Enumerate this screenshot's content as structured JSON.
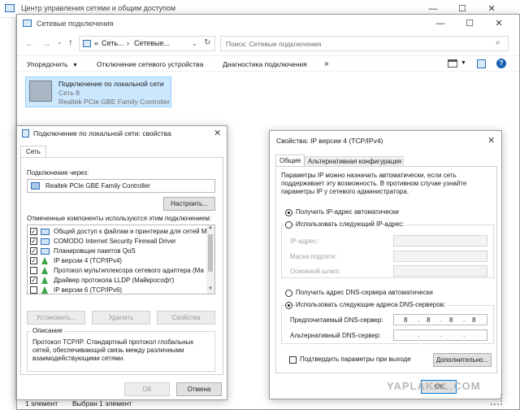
{
  "bg_window": {
    "title": "Центр управления сетями и общим доступом"
  },
  "explorer": {
    "title": "Сетевые подключения",
    "breadcrumb_prefix": "«",
    "breadcrumb_1": "Сеть...",
    "breadcrumb_sep": "›",
    "breadcrumb_2": "Сетевые...",
    "search_placeholder": "Поиск: Сетевые подключения",
    "toolbar": {
      "organize": "Упорядочить",
      "disable": "Отключение сетевого устройства",
      "diagnose": "Диагностика подключения",
      "rename_overflow": "»"
    },
    "connection": {
      "name": "Подключение по локальной сети",
      "network": "Сеть  8",
      "adapter": "Realtek PCIe GBE Family Controller"
    },
    "status": {
      "count": "1 элемент",
      "selected": "Выбран 1 элемент"
    }
  },
  "props": {
    "title": "Подключение по локальной сети: свойства",
    "tab": "Сеть",
    "connect_via_label": "Подключение через:",
    "adapter": "Realtek PCIe GBE Family Controller",
    "configure": "Настроить...",
    "components_label": "Отмеченные компоненты используются этим подключением:",
    "components": [
      {
        "checked": true,
        "label": "Общий доступ к файлам и принтерам для сетей Mi"
      },
      {
        "checked": true,
        "label": "COMODO Internet Security Firewall Driver"
      },
      {
        "checked": true,
        "label": "Планировщик пакетов QoS"
      },
      {
        "checked": true,
        "label": "IP версии 4 (TCP/IPv4)"
      },
      {
        "checked": false,
        "label": "Протокол мультиплексора сетевого адаптера (Ма"
      },
      {
        "checked": true,
        "label": "Драйвер протокола LLDP (Майкрософт)"
      },
      {
        "checked": false,
        "label": "IP версии 6 (TCP/IPv6)"
      }
    ],
    "install": "Установить...",
    "remove": "Удалить",
    "properties": "Свойства",
    "description_title": "Описание",
    "description": "Протокол TCP/IP. Стандартный протокол глобальных сетей, обеспечивающий связь между различными взаимодействующими сетями.",
    "ok": "ОК",
    "cancel": "Отмена"
  },
  "ipv4": {
    "title": "Свойства: IP версии 4 (TCP/IPv4)",
    "tab_general": "Общие",
    "tab_alt": "Альтернативная конфигурация",
    "intro": "Параметры IP можно назначать автоматически, если сеть поддерживает эту возможность. В противном случае узнайте параметры IP у сетевого администратора.",
    "ip_auto": "Получить IP-адрес автоматически",
    "ip_manual": "Использовать следующий IP-адрес:",
    "ip_address": "IP-адрес:",
    "subnet": "Маска подсети:",
    "gateway": "Основной шлюз:",
    "dns_auto": "Получить адрес DNS-сервера автоматически",
    "dns_manual": "Использовать следующие адреса DNS-серверов:",
    "dns_preferred_label": "Предпочитаемый DNS-сервер:",
    "dns_preferred": [
      "8",
      "8",
      "8",
      "8"
    ],
    "dns_alt_label": "Альтернативный DNS-сервер:",
    "dns_alt": [
      "",
      "",
      "",
      ""
    ],
    "validate": "Подтвердить параметры при выходе",
    "advanced": "Дополнительно...",
    "ok": "ОК"
  },
  "watermark": "YAPLAKAL.COM",
  "colors": {
    "accent": "#0078d7",
    "selection": "#cce8ff",
    "link_blue": "#1a5fb4"
  }
}
